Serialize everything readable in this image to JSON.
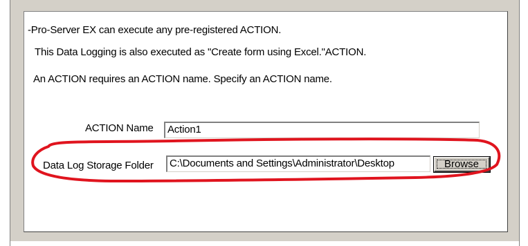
{
  "intro": {
    "line1": "-Pro-Server EX can execute any pre-registered ACTION.",
    "line2": "This Data Logging is also executed as \"Create form using Excel.\"ACTION.",
    "line3": "An ACTION requires an ACTION  name. Specify an ACTION name."
  },
  "action_name": {
    "label": "ACTION Name",
    "value": "Action1"
  },
  "data_log_folder": {
    "label": "Data Log Storage Folder",
    "value": "C:\\Documents and Settings\\Administrator\\Desktop",
    "browse_label": "Browse"
  },
  "highlight_color": "#e0141e"
}
